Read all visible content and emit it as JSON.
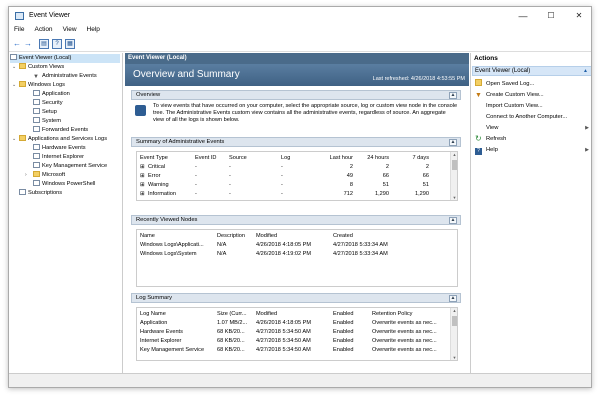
{
  "window": {
    "title": "Event Viewer",
    "min": "—",
    "max": "☐",
    "close": "✕"
  },
  "menu": [
    "File",
    "Action",
    "View",
    "Help"
  ],
  "toolbar": {
    "back": "←",
    "forward": "→",
    "b1": "▤",
    "b2": "?",
    "b3": "▦"
  },
  "tree": {
    "root": "Event Viewer (Local)",
    "custom_views": "Custom Views",
    "admin_events": "Administrative Events",
    "windows_logs": "Windows Logs",
    "application": "Application",
    "security": "Security",
    "setup": "Setup",
    "system": "System",
    "forwarded": "Forwarded Events",
    "app_services": "Applications and Services Logs",
    "hardware": "Hardware Events",
    "ie": "Internet Explorer",
    "kms": "Key Management Service",
    "microsoft": "Microsoft",
    "powershell": "Windows PowerShell",
    "subscriptions": "Subscriptions"
  },
  "center": {
    "header": "Event Viewer (Local)",
    "banner_title": "Overview and Summary",
    "last_refreshed": "Last refreshed: 4/26/2018 4:53:55 PM",
    "overview": {
      "title": "Overview",
      "text": "To view events that have occurred on your computer, select the appropriate source, log or custom view node in the console tree. The Administrative Events custom view contains all the administrative events, regardless of source. An aggregate view of all the logs is shown below."
    },
    "summary": {
      "title": "Summary of Administrative Events",
      "headers": [
        "Event Type",
        "Event ID",
        "Source",
        "Log",
        "Last hour",
        "24 hours",
        "7 days"
      ],
      "rows": [
        [
          "Critical",
          "-",
          "-",
          "-",
          "2",
          "2",
          "2"
        ],
        [
          "Error",
          "-",
          "-",
          "-",
          "49",
          "66",
          "66"
        ],
        [
          "Warning",
          "-",
          "-",
          "-",
          "8",
          "51",
          "51"
        ],
        [
          "Information",
          "-",
          "-",
          "-",
          "712",
          "1,290",
          "1,290"
        ]
      ]
    },
    "recent": {
      "title": "Recently Viewed Nodes",
      "headers": [
        "Name",
        "Description",
        "Modified",
        "Created"
      ],
      "rows": [
        [
          "Windows Logs\\Applicati...",
          "N/A",
          "4/26/2018 4:18:05 PM",
          "4/27/2018 5:33:34 AM"
        ],
        [
          "Windows Logs\\System",
          "N/A",
          "4/26/2018 4:19:02 PM",
          "4/27/2018 5:33:34 AM"
        ]
      ]
    },
    "logsummary": {
      "title": "Log Summary",
      "headers": [
        "Log Name",
        "Size (Curr...",
        "Modified",
        "Enabled",
        "Retention Policy"
      ],
      "rows": [
        [
          "Application",
          "1.07 MB/2...",
          "4/26/2018 4:18:05 PM",
          "Enabled",
          "Overwrite events as nec..."
        ],
        [
          "Hardware Events",
          "68 KB/20...",
          "4/27/2018 5:34:50 AM",
          "Enabled",
          "Overwrite events as nec..."
        ],
        [
          "Internet Explorer",
          "68 KB/20...",
          "4/27/2018 5:34:50 AM",
          "Enabled",
          "Overwrite events as nec..."
        ],
        [
          "Key Management Service",
          "68 KB/20...",
          "4/27/2018 5:34:50 AM",
          "Enabled",
          "Overwrite events as nec..."
        ]
      ]
    }
  },
  "actions": {
    "title": "Actions",
    "selected": "Event Viewer (Local)",
    "items": [
      "Open Saved Log...",
      "Create Custom View...",
      "Import Custom View...",
      "Connect to Another Computer...",
      "View",
      "Refresh",
      "Help"
    ]
  }
}
